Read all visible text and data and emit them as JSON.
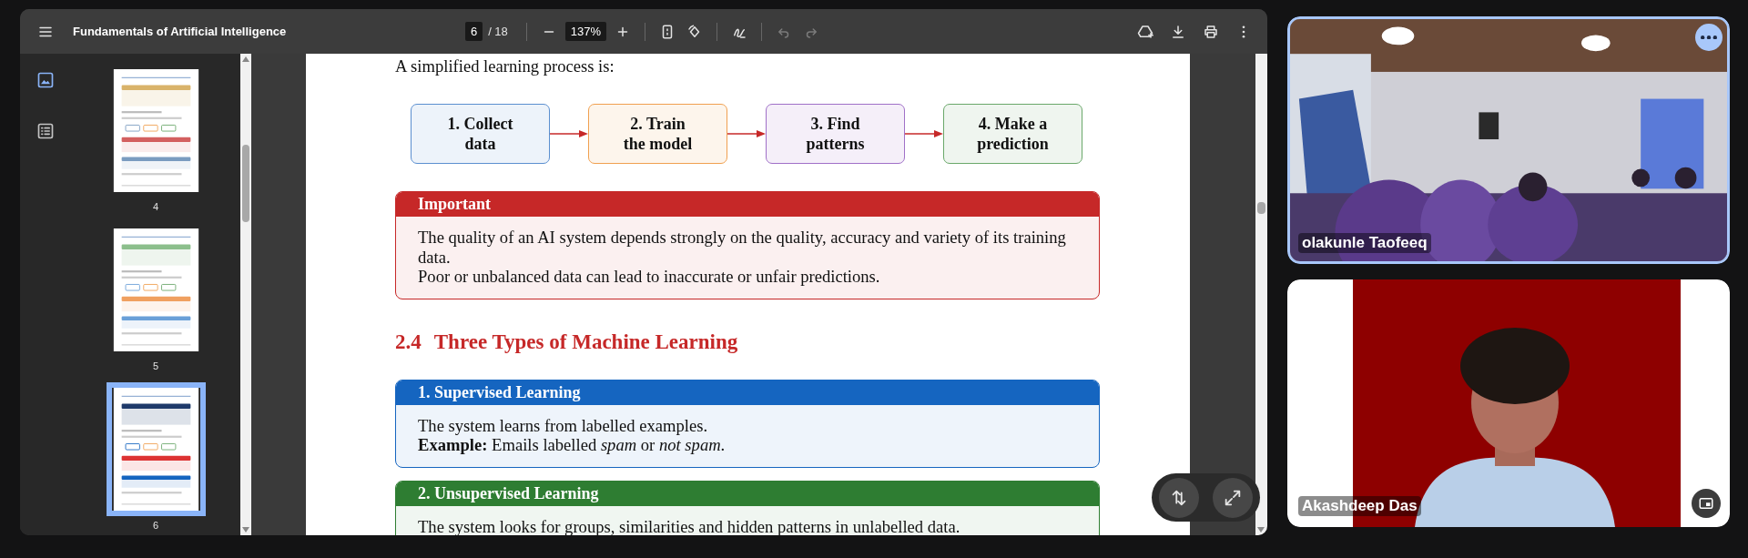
{
  "viewer": {
    "title": "Fundamentals of Artificial Intelligence",
    "page_input": "6",
    "page_total": "/ 18",
    "zoom": "137%",
    "sidebar": {
      "views": [
        {
          "kind": "thumbnails",
          "selected": true
        },
        {
          "kind": "outline",
          "selected": false
        }
      ],
      "thumbnails": [
        {
          "label": "4",
          "selected": false
        },
        {
          "label": "5",
          "selected": false
        },
        {
          "label": "6",
          "selected": true
        }
      ]
    },
    "document": {
      "intro": "A simplified learning process is:",
      "flow_steps": [
        {
          "line1": "1. Collect",
          "line2": "data",
          "color": "#5b8fd0"
        },
        {
          "line1": "2. Train",
          "line2": "the model",
          "color": "#f0a050"
        },
        {
          "line1": "3. Find",
          "line2": "patterns",
          "color": "#a070c8"
        },
        {
          "line1": "4. Make a",
          "line2": "prediction",
          "color": "#6aa86a"
        }
      ],
      "callouts": [
        {
          "title": "Important",
          "color": "#c62828",
          "paragraphs": [
            "The quality of an AI system depends strongly on the quality, accuracy and variety of its training data.",
            "Poor or unbalanced data can lead to inaccurate or unfair predictions."
          ]
        }
      ],
      "section": {
        "number": "2.4",
        "title": "Three Types of Machine Learning"
      },
      "type_boxes": [
        {
          "title": "1. Supervised Learning",
          "color": "#1565c0",
          "paragraphs": [
            "The system learns from labelled examples.",
            "**Example:** Emails labelled *spam* or *not spam*."
          ]
        },
        {
          "title": "2. Unsupervised Learning",
          "color": "#2e7d32",
          "paragraphs": [
            "The system looks for groups, similarities and hidden patterns in unlabelled data."
          ]
        }
      ]
    }
  },
  "video_tiles": [
    {
      "name": "olakunle Taofeeq",
      "highlighted": true,
      "kind": "room"
    },
    {
      "name": "Akashdeep Das",
      "highlighted": false,
      "kind": "person"
    }
  ]
}
